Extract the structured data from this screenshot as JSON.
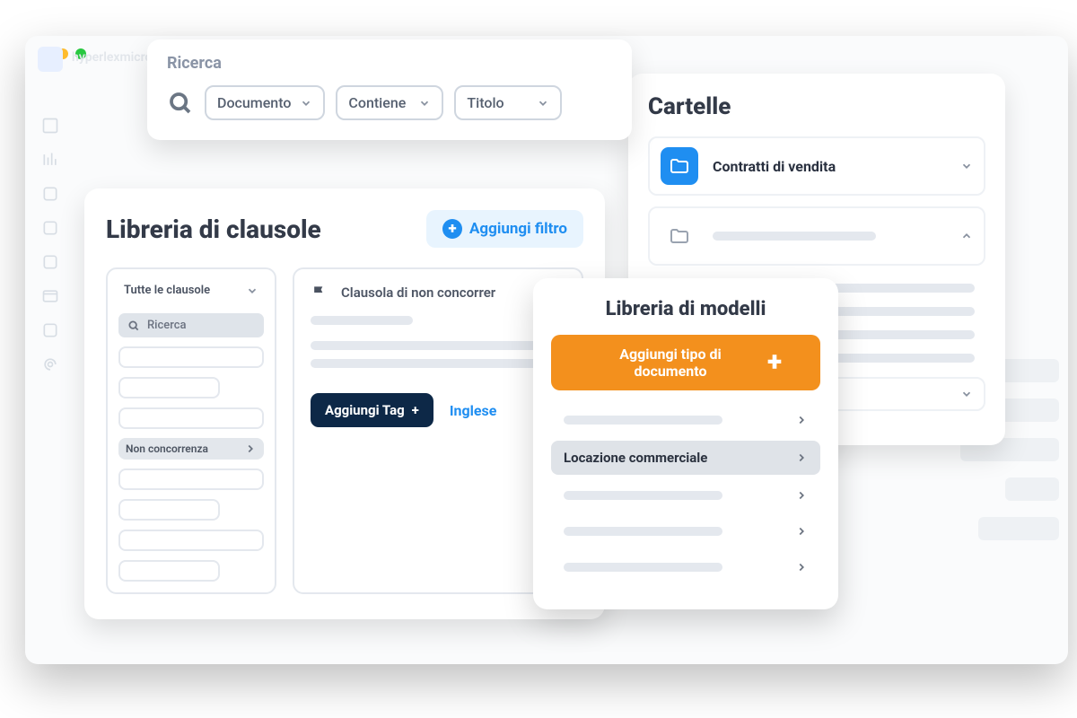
{
  "bg": {
    "title_hint": "hyperlexmicros…"
  },
  "search": {
    "title": "Ricerca",
    "selects": [
      {
        "label": "Documento"
      },
      {
        "label": "Contiene"
      },
      {
        "label": "Titolo"
      }
    ]
  },
  "clause": {
    "title": "Libreria di clausole",
    "add_filter": "Aggiungi filtro",
    "side_select": "Tutte le clausole",
    "side_search": "Ricerca",
    "tag_sample": "Non concorrenza",
    "main_title": "Clausola di non concorrer",
    "add_tag": "Aggiungi Tag",
    "language": "Inglese"
  },
  "folders": {
    "title": "Cartelle",
    "selected": "Contratti di vendita"
  },
  "models": {
    "title": "Libreria di modelli",
    "add_doc": "Aggiungi tipo di documento",
    "selected": "Locazione commerciale"
  }
}
